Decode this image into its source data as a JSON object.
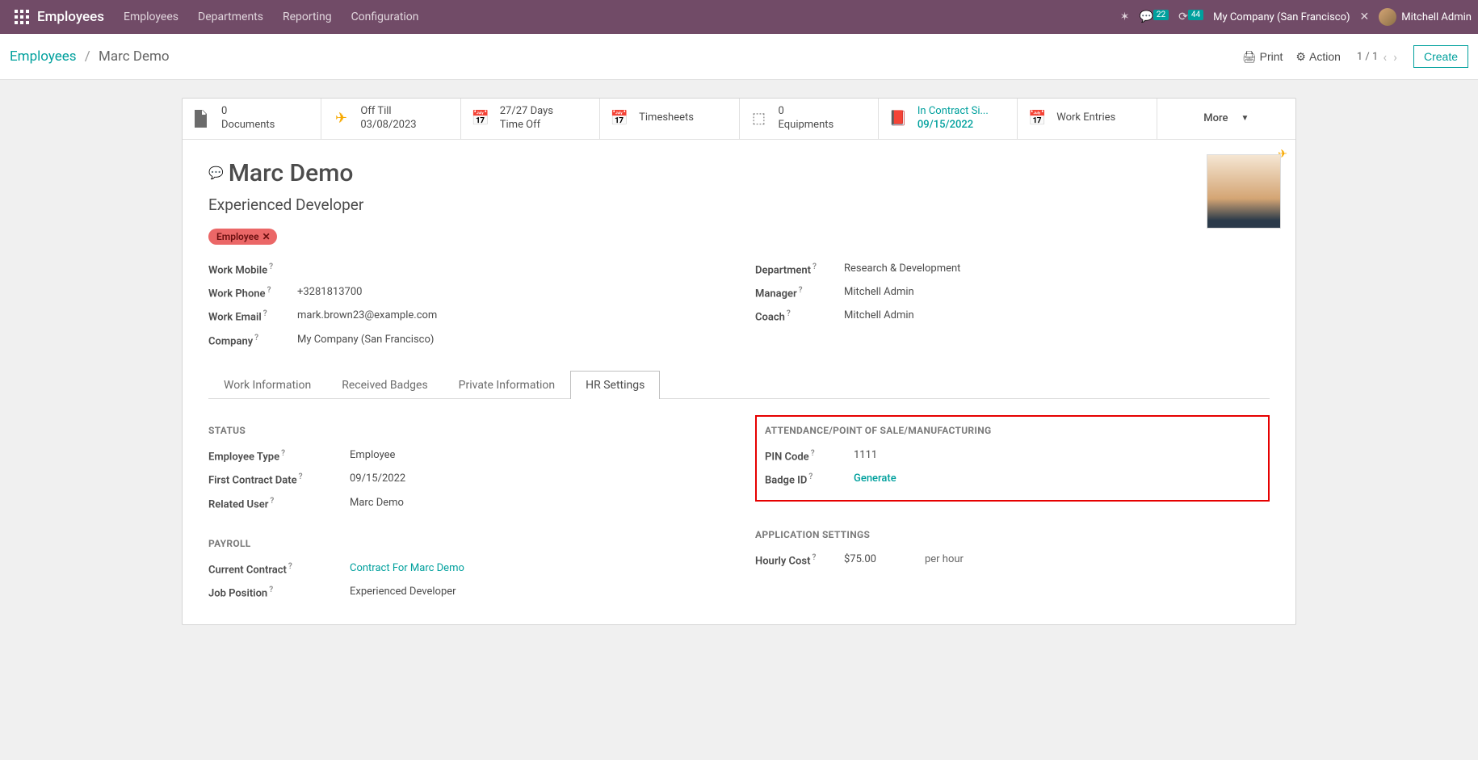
{
  "topnav": {
    "app": "Employees",
    "menu": [
      "Employees",
      "Departments",
      "Reporting",
      "Configuration"
    ],
    "chat_count": "22",
    "clock_count": "44",
    "company": "My Company (San Francisco)",
    "user": "Mitchell Admin"
  },
  "breadcrumb": {
    "root": "Employees",
    "current": "Marc Demo"
  },
  "controls": {
    "print": "Print",
    "action": "Action",
    "pager": "1 / 1",
    "create": "Create"
  },
  "statbtns": {
    "docs": {
      "l1": "0",
      "l2": "Documents"
    },
    "off": {
      "l1": "Off Till",
      "l2": "03/08/2023"
    },
    "timeoff": {
      "l1": "27/27 Days",
      "l2": "Time Off"
    },
    "timesheets": {
      "l1": "Timesheets"
    },
    "equip": {
      "l1": "0",
      "l2": "Equipments"
    },
    "contract": {
      "l1": "In Contract Si...",
      "l2": "09/15/2022"
    },
    "workentries": {
      "l1": "Work Entries"
    },
    "more": "More"
  },
  "employee": {
    "name": "Marc Demo",
    "job": "Experienced Developer",
    "tag": "Employee",
    "work_mobile_label": "Work Mobile",
    "work_mobile": "",
    "work_phone_label": "Work Phone",
    "work_phone": "+3281813700",
    "work_email_label": "Work Email",
    "work_email": "mark.brown23@example.com",
    "company_label": "Company",
    "company": "My Company (San Francisco)",
    "department_label": "Department",
    "department": "Research & Development",
    "manager_label": "Manager",
    "manager": "Mitchell Admin",
    "coach_label": "Coach",
    "coach": "Mitchell Admin"
  },
  "tabs": [
    "Work Information",
    "Received Badges",
    "Private Information",
    "HR Settings"
  ],
  "hr": {
    "status_h": "STATUS",
    "emp_type_label": "Employee Type",
    "emp_type": "Employee",
    "first_contract_label": "First Contract Date",
    "first_contract": "09/15/2022",
    "related_user_label": "Related User",
    "related_user": "Marc Demo",
    "att_h": "ATTENDANCE/POINT OF SALE/MANUFACTURING",
    "pin_label": "PIN Code",
    "pin": "1111",
    "badge_label": "Badge ID",
    "generate": "Generate",
    "payroll_h": "PAYROLL",
    "cur_contract_label": "Current Contract",
    "cur_contract": "Contract For Marc Demo",
    "job_pos_label": "Job Position",
    "job_pos": "Experienced Developer",
    "app_h": "APPLICATION SETTINGS",
    "hourly_label": "Hourly Cost",
    "hourly": "$75.00",
    "hourly_unit": "per hour"
  }
}
